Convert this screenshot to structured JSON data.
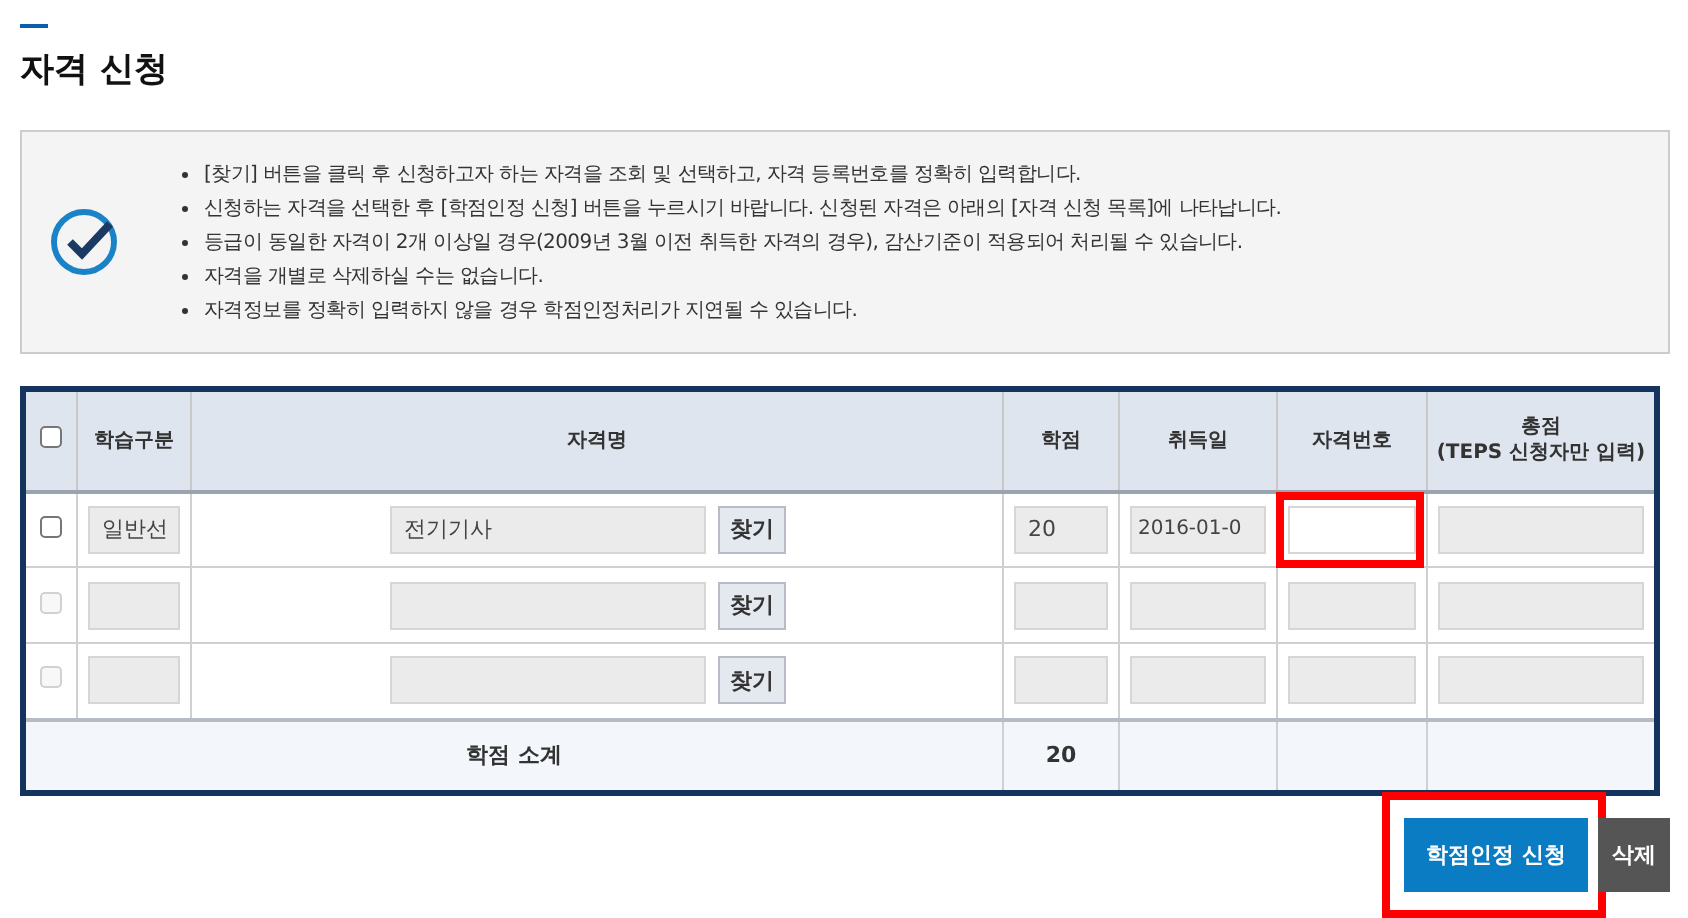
{
  "page_title": "자격 신청",
  "notice": {
    "items": [
      "[찾기] 버튼을 클릭 후 신청하고자 하는 자격을 조회 및 선택하고, 자격 등록번호를 정확히 입력합니다.",
      "신청하는 자격을 선택한 후 [학점인정 신청] 버튼을 누르시기 바랍니다. 신청된 자격은 아래의 [자격 신청 목록]에 나타납니다.",
      "등급이 동일한 자격이 2개 이상일 경우(2009년 3월 이전 취득한 자격의 경우), 감산기준이 적용되어 처리될 수 있습니다.",
      "자격을 개별로 삭제하실 수는 없습니다.",
      "자격정보를 정확히 입력하지 않을 경우 학점인정처리가 지연될 수 있습니다."
    ]
  },
  "table": {
    "select_all": {
      "checked": false
    },
    "columns": [
      "학습구분",
      "자격명",
      "학점",
      "취득일",
      "자격번호",
      "총점\n(TEPS 신청자만 입력)"
    ],
    "rows": [
      {
        "checked": false,
        "disabled": false,
        "category": "일반선",
        "name": "전기기사",
        "find_button": "찾기",
        "credits": "20",
        "date": "2016-01-0",
        "number": "",
        "number_highlighted": true,
        "score": ""
      },
      {
        "checked": false,
        "disabled": true,
        "category": "",
        "name": "",
        "find_button": "찾기",
        "credits": "",
        "date": "",
        "number": "",
        "number_highlighted": false,
        "score": ""
      },
      {
        "checked": false,
        "disabled": true,
        "category": "",
        "name": "",
        "find_button": "찾기",
        "credits": "",
        "date": "",
        "number": "",
        "number_highlighted": false,
        "score": ""
      }
    ],
    "subtotal": {
      "label": "학점 소계",
      "credits": "20"
    }
  },
  "buttons": [
    {
      "label": "학점인정 신청",
      "kind": "primary",
      "highlighted": true
    },
    {
      "label": "삭제",
      "kind": "secondary",
      "highlighted": false
    }
  ]
}
